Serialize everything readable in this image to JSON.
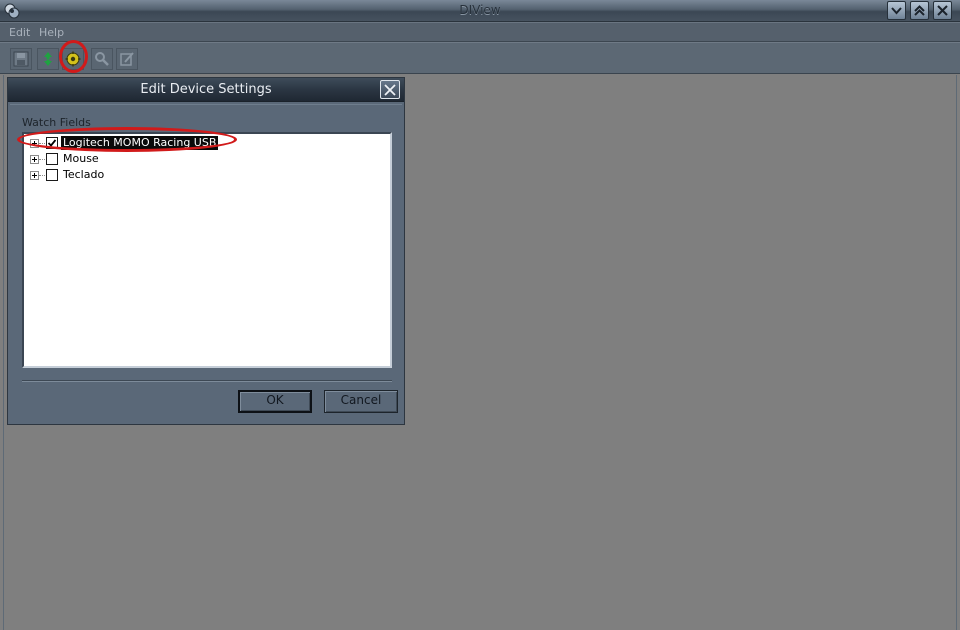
{
  "window": {
    "title": "DIView"
  },
  "menu": {
    "items": [
      {
        "label": "Edit"
      },
      {
        "label": "Help"
      }
    ]
  },
  "toolbar": {
    "buttons": [
      {
        "icon": "save-icon",
        "enabled": false
      },
      {
        "icon": "refresh-arrows-icon",
        "enabled": true
      },
      {
        "icon": "device-settings-gear-icon",
        "enabled": true,
        "highlighted": true
      },
      {
        "icon": "magnifier-icon",
        "enabled": false
      },
      {
        "icon": "edit-icon",
        "enabled": false
      }
    ]
  },
  "dialog": {
    "title": "Edit Device Settings",
    "group_label": "Watch Fields",
    "devices": [
      {
        "label": "Logitech MOMO Racing USB",
        "checked": true,
        "selected": true
      },
      {
        "label": "Mouse",
        "checked": false,
        "selected": false
      },
      {
        "label": "Teclado",
        "checked": false,
        "selected": false
      }
    ],
    "ok_label": "OK",
    "cancel_label": "Cancel"
  },
  "colors": {
    "annotation_red": "#d11a1a",
    "workspace_gray": "#7f7f7f",
    "chrome_slate": "#5a6878"
  }
}
